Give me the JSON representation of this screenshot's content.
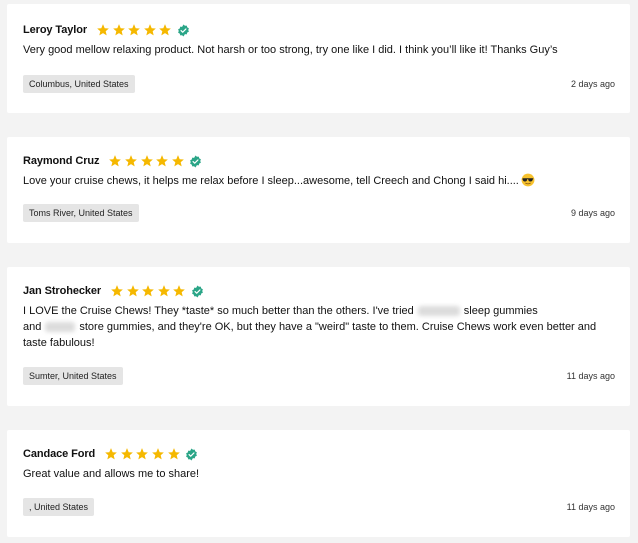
{
  "colors": {
    "page_bg": "#f3f3f3",
    "card_bg": "#ffffff",
    "star": "#f5b800",
    "verified": "#2aa587",
    "tag_bg": "#e5e5e5"
  },
  "reviews": [
    {
      "name": "Leroy Taylor",
      "rating": 5,
      "verified": true,
      "text": "Very good mellow relaxing product. Not harsh or too strong, try one like I did. I think you’ll like it! Thanks Guy’s",
      "location": "Columbus, United States",
      "time": "2 days ago"
    },
    {
      "name": "Raymond Cruz",
      "rating": 5,
      "verified": true,
      "text": "Love your cruise chews, it helps me relax before I sleep...awesome,  tell Creech and Chong I said hi....",
      "emoji": "sunglasses-emoji",
      "location": "Toms River, United States",
      "time": "9 days ago"
    },
    {
      "name": "Jan Strohecker",
      "rating": 5,
      "verified": true,
      "text_part1": "I LOVE the Cruise Chews!  They *taste* so much better than the others.  I've tried",
      "text_part2": "sleep gummies",
      "text_part3": "and",
      "text_part4": "store gummies, and they're OK, but they have a \"weird\" taste to them.  Cruise Chews work even better and taste fabulous!",
      "location": "Sumter, United States",
      "time": "11 days ago"
    },
    {
      "name": "Candace Ford",
      "rating": 5,
      "verified": true,
      "text": "Great value and allows me to share!",
      "location": ", United States",
      "time": "11 days ago"
    }
  ]
}
